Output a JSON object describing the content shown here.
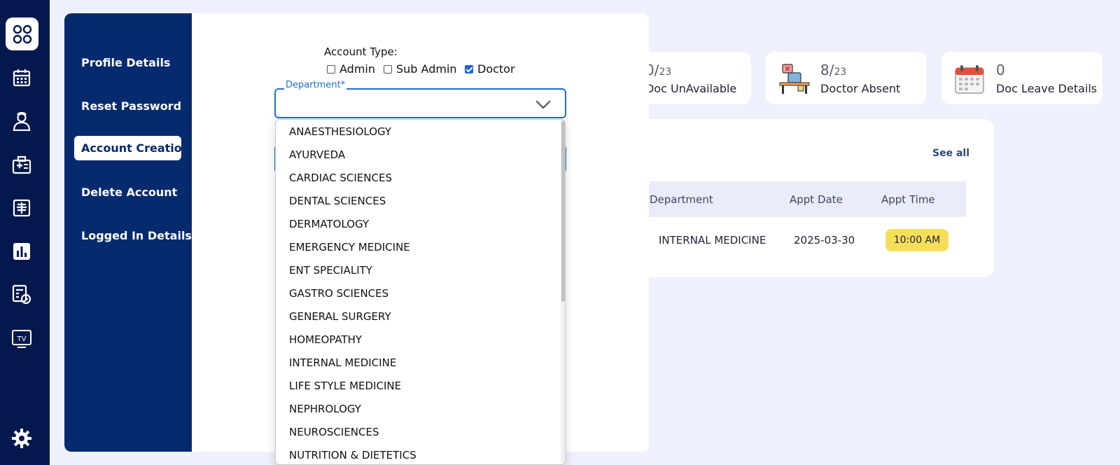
{
  "rail": {
    "icons": [
      "apps-icon",
      "calendar-icon",
      "doctor-icon",
      "medical-id-icon",
      "xray-icon",
      "bar-chart-icon",
      "billing-clock-icon",
      "tv-icon",
      "gear-icon"
    ],
    "tv_text": "TV"
  },
  "stats": [
    {
      "num": "0/",
      "total": "23",
      "label": "Doc UnAvailable"
    },
    {
      "num": "8/",
      "total": "23",
      "label": "Doctor Absent"
    },
    {
      "num": "0",
      "total": "",
      "label": "Doc Leave Details"
    }
  ],
  "appointments": {
    "see_all": "See all",
    "headers": [
      "Department",
      "Appt Date",
      "Appt Time"
    ],
    "row": {
      "department": "INTERNAL MEDICINE",
      "date": "2025-03-30",
      "time": "10:00 AM"
    }
  },
  "modal": {
    "nav": [
      "Profile Details",
      "Reset Password",
      "Account Creation",
      "Delete Account",
      "Logged In Details"
    ],
    "active_nav": "Account Creation",
    "account_type_label": "Account Type:",
    "account_types": [
      {
        "label": "Admin",
        "checked": false
      },
      {
        "label": "Sub Admin",
        "checked": false
      },
      {
        "label": "Doctor",
        "checked": true
      }
    ],
    "department_label": "Department*",
    "department_value": "",
    "department_options": [
      "ANAESTHESIOLOGY",
      "AYURVEDA",
      "CARDIAC SCIENCES",
      "DENTAL SCIENCES",
      "DERMATOLOGY",
      "EMERGENCY MEDICINE",
      "ENT SPECIALITY",
      "GASTRO SCIENCES",
      "GENERAL SURGERY",
      "HOMEOPATHY",
      "INTERNAL MEDICINE",
      "LIFE STYLE MEDICINE",
      "NEPHROLOGY",
      "NEUROSCIENCES",
      "NUTRITION & DIETETICS"
    ]
  },
  "colors": {
    "rail_bg": "#05184d",
    "modal_nav_bg": "#052a6e",
    "accent_blue": "#1f6fd1",
    "badge_yellow": "#f5df5a",
    "page_bg": "#eef0fc"
  }
}
